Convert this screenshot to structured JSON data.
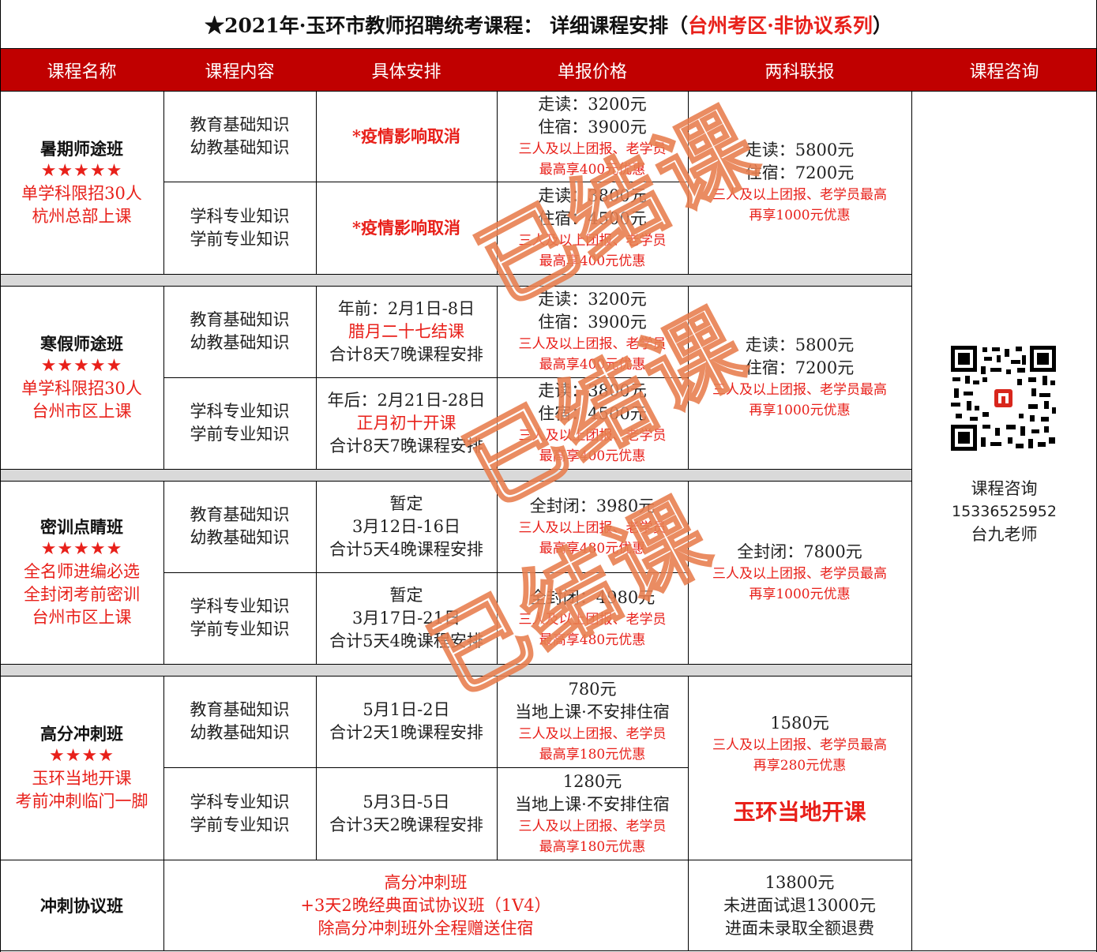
{
  "title": {
    "main": "★2021年·玉环市教师招聘统考课程：  详细课程安排（",
    "highlight": "台州考区·非协议系列",
    "tail": "）"
  },
  "headers": [
    "课程名称",
    "课程内容",
    "具体安排",
    "单报价格",
    "两科联报",
    "课程咨询"
  ],
  "sections": [
    {
      "name": "暑期师途班",
      "stars": "★★★★★",
      "notes": [
        "单学科限招30人",
        "杭州总部上课"
      ],
      "rows": [
        {
          "content": [
            "教育基础知识",
            "幼教基础知识"
          ],
          "schedule": [
            {
              "t": "*疫情影响取消",
              "red": true,
              "bold": true
            }
          ],
          "price": [
            "走读：3200元",
            "住宿：3900元"
          ],
          "price_note": [
            "三人及以上团报、老学员",
            "最高享400元优惠"
          ]
        },
        {
          "content": [
            "学科专业知识",
            "学前专业知识"
          ],
          "schedule": [
            {
              "t": "*疫情影响取消",
              "red": true,
              "bold": true
            }
          ],
          "price": [
            "走读：3800元",
            "住宿：4500元"
          ],
          "price_note": [
            "三人及以上团报、老学员",
            "最高享400元优惠"
          ]
        }
      ],
      "combo": [
        "走读：5800元",
        "住宿：7200元"
      ],
      "combo_note": [
        "三人及以上团报、老学员最高",
        "再享1000元优惠"
      ]
    },
    {
      "name": "寒假师途班",
      "stars": "★★★★★",
      "notes": [
        "单学科限招30人",
        "台州市区上课"
      ],
      "rows": [
        {
          "content": [
            "教育基础知识",
            "幼教基础知识"
          ],
          "schedule": [
            {
              "t": "年前：2月1日-8日"
            },
            {
              "t": "腊月二十七结课",
              "red": true
            },
            {
              "t": "合计8天7晚课程安排"
            }
          ],
          "price": [
            "走读：3200元",
            "住宿：3900元"
          ],
          "price_note": [
            "三人及以上团报、老学员",
            "最高享400元优惠"
          ]
        },
        {
          "content": [
            "学科专业知识",
            "学前专业知识"
          ],
          "schedule": [
            {
              "t": "年后：2月21日-28日"
            },
            {
              "t": "正月初十开课",
              "red": true
            },
            {
              "t": "合计8天7晚课程安排"
            }
          ],
          "price": [
            "走读：3800元",
            "住宿：4500元"
          ],
          "price_note": [
            "三人及以上团报、老学员",
            "最高享400元优惠"
          ]
        }
      ],
      "combo": [
        "走读：5800元",
        "住宿：7200元"
      ],
      "combo_note": [
        "三人及以上团报、老学员最高",
        "再享1000元优惠"
      ]
    },
    {
      "name": "密训点睛班",
      "stars": "★★★★★",
      "notes": [
        "全名师进编必选",
        "全封闭考前密训",
        "台州市区上课"
      ],
      "rows": [
        {
          "content": [
            "教育基础知识",
            "幼教基础知识"
          ],
          "schedule": [
            {
              "t": "暂定"
            },
            {
              "t": "3月12日-16日"
            },
            {
              "t": "合计5天4晚课程安排"
            }
          ],
          "price": [
            "全封闭：3980元"
          ],
          "price_note": [
            "三人及以上团报、老学员",
            "最高享480元优惠"
          ]
        },
        {
          "content": [
            "学科专业知识",
            "学前专业知识"
          ],
          "schedule": [
            {
              "t": "暂定"
            },
            {
              "t": "3月17日-21日"
            },
            {
              "t": "合计5天4晚课程安排"
            }
          ],
          "price": [
            "全封闭：4980元"
          ],
          "price_note": [
            "三人及以上团报、老学员",
            "最高享480元优惠"
          ]
        }
      ],
      "combo": [
        "全封闭：7800元"
      ],
      "combo_note": [
        "三人及以上团报、老学员最高",
        "再享1000元优惠"
      ]
    },
    {
      "name": "高分冲刺班",
      "stars": "★★★★",
      "notes": [
        "玉环当地开课",
        "考前冲刺临门一脚"
      ],
      "rows": [
        {
          "content": [
            "教育基础知识",
            "幼教基础知识"
          ],
          "schedule": [
            {
              "t": "5月1日-2日"
            },
            {
              "t": "合计2天1晚课程安排"
            }
          ],
          "price": [
            "780元",
            "当地上课·不安排住宿"
          ],
          "price_note": [
            "三人及以上团报、老学员",
            "最高享180元优惠"
          ]
        },
        {
          "content": [
            "学科专业知识",
            "学前专业知识"
          ],
          "schedule": [
            {
              "t": "5月3日-5日"
            },
            {
              "t": "合计3天2晚课程安排"
            }
          ],
          "price": [
            "1280元",
            "当地上课·不安排住宿"
          ],
          "price_note": [
            "三人及以上团报、老学员",
            "最高享180元优惠"
          ]
        }
      ],
      "combo": [
        "1580元"
      ],
      "combo_note": [
        "三人及以上团报、老学员最高",
        "再享280元优惠"
      ],
      "combo_extra": "玉环当地开课"
    }
  ],
  "agreement": {
    "name": "冲刺协议班",
    "desc": [
      "高分冲刺班",
      "+3天2晚经典面试协议班（1V4）",
      "除高分冲刺班外全程赠送住宿"
    ],
    "combo": [
      "13800元",
      "未进面试退13000元",
      "进面未录取全额退费"
    ]
  },
  "consult": {
    "label": "课程咨询",
    "phone": "15336525952",
    "teacher": "台九老师"
  },
  "stamp_text": "已结课",
  "colors": {
    "header_bg": "#c00000",
    "header_text": "#ffffff",
    "accent_red": "#e8201a",
    "separator": "#d9d9d9"
  }
}
